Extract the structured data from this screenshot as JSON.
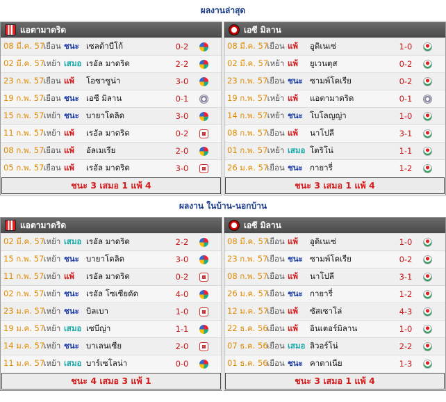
{
  "sections": [
    {
      "title": "ผลงานล่าสุด",
      "left": {
        "team": "แอตามาดริด",
        "logo": "atletico-crest",
        "rows": [
          {
            "date": "08 มี.ค. 57",
            "ha": "เยือน",
            "result": "ชนะ",
            "rclass": "win",
            "opponent": "เซลต้าบีโก้",
            "score": "0-2",
            "comp": "liga"
          },
          {
            "date": "02 มี.ค. 57",
            "ha": "เหย้า",
            "result": "เสมอ",
            "rclass": "draw",
            "opponent": "เรอัล มาดริด",
            "score": "2-2",
            "comp": "liga"
          },
          {
            "date": "23 ก.พ. 57",
            "ha": "เยือน",
            "result": "แพ้",
            "rclass": "loss",
            "opponent": "โอซาซูน่า",
            "score": "3-0",
            "comp": "liga"
          },
          {
            "date": "19 ก.พ. 57",
            "ha": "เยือน",
            "result": "ชนะ",
            "rclass": "win",
            "opponent": "เอซี มิลาน",
            "score": "0-1",
            "comp": "ucl"
          },
          {
            "date": "15 ก.พ. 57",
            "ha": "เหย้า",
            "result": "ชนะ",
            "rclass": "win",
            "opponent": "บายาโดลิด",
            "score": "3-0",
            "comp": "liga"
          },
          {
            "date": "11 ก.พ. 57",
            "ha": "เหย้า",
            "result": "แพ้",
            "rclass": "loss",
            "opponent": "เรอัล มาดริด",
            "score": "0-2",
            "comp": "cup"
          },
          {
            "date": "08 ก.พ. 57",
            "ha": "เยือน",
            "result": "แพ้",
            "rclass": "loss",
            "opponent": "อัลเมเรีย",
            "score": "2-0",
            "comp": "liga"
          },
          {
            "date": "05 ก.พ. 57",
            "ha": "เยือน",
            "result": "แพ้",
            "rclass": "loss",
            "opponent": "เรอัล มาดริด",
            "score": "3-0",
            "comp": "cup"
          }
        ],
        "summary": "ชนะ 3 เสมอ 1 แพ้ 4"
      },
      "right": {
        "team": "เอซี มิลาน",
        "logo": "milan-crest",
        "rows": [
          {
            "date": "08 มี.ค. 57",
            "ha": "เยือน",
            "result": "แพ้",
            "rclass": "loss",
            "opponent": "อูดิเนเซ่",
            "score": "1-0",
            "comp": "seriea"
          },
          {
            "date": "02 มี.ค. 57",
            "ha": "เหย้า",
            "result": "แพ้",
            "rclass": "loss",
            "opponent": "ยูเวนตุส",
            "score": "0-2",
            "comp": "seriea"
          },
          {
            "date": "23 ก.พ. 57",
            "ha": "เยือน",
            "result": "ชนะ",
            "rclass": "win",
            "opponent": "ซามพ์โดเรีย",
            "score": "0-2",
            "comp": "seriea"
          },
          {
            "date": "19 ก.พ. 57",
            "ha": "เหย้า",
            "result": "แพ้",
            "rclass": "loss",
            "opponent": "แอตามาดริด",
            "score": "0-1",
            "comp": "ucl"
          },
          {
            "date": "14 ก.พ. 57",
            "ha": "เหย้า",
            "result": "ชนะ",
            "rclass": "win",
            "opponent": "โบโลญญ่า",
            "score": "1-0",
            "comp": "seriea"
          },
          {
            "date": "08 ก.พ. 57",
            "ha": "เยือน",
            "result": "แพ้",
            "rclass": "loss",
            "opponent": "นาโปลี",
            "score": "3-1",
            "comp": "seriea"
          },
          {
            "date": "01 ก.พ. 57",
            "ha": "เหย้า",
            "result": "เสมอ",
            "rclass": "draw",
            "opponent": "โตริโน่",
            "score": "1-1",
            "comp": "seriea"
          },
          {
            "date": "26 ม.ค. 57",
            "ha": "เยือน",
            "result": "ชนะ",
            "rclass": "win",
            "opponent": "กายารี่",
            "score": "1-2",
            "comp": "seriea"
          }
        ],
        "summary": "ชนะ 3 เสมอ 1 แพ้ 4"
      }
    },
    {
      "title": "ผลงาน ในบ้าน-นอกบ้าน",
      "left": {
        "team": "แอตามาดริด",
        "logo": "atletico-crest",
        "rows": [
          {
            "date": "02 มี.ค. 57",
            "ha": "เหย้า",
            "result": "เสมอ",
            "rclass": "draw",
            "opponent": "เรอัล มาดริด",
            "score": "2-2",
            "comp": "liga"
          },
          {
            "date": "15 ก.พ. 57",
            "ha": "เหย้า",
            "result": "ชนะ",
            "rclass": "win",
            "opponent": "บายาโดลิด",
            "score": "3-0",
            "comp": "liga"
          },
          {
            "date": "11 ก.พ. 57",
            "ha": "เหย้า",
            "result": "แพ้",
            "rclass": "loss",
            "opponent": "เรอัล มาดริด",
            "score": "0-2",
            "comp": "cup"
          },
          {
            "date": "02 ก.พ. 57",
            "ha": "เหย้า",
            "result": "ชนะ",
            "rclass": "win",
            "opponent": "เรอัล โซเซียดัด",
            "score": "4-0",
            "comp": "liga"
          },
          {
            "date": "23 ม.ค. 57",
            "ha": "เหย้า",
            "result": "ชนะ",
            "rclass": "win",
            "opponent": "บิลเบา",
            "score": "1-0",
            "comp": "cup"
          },
          {
            "date": "19 ม.ค. 57",
            "ha": "เหย้า",
            "result": "เสมอ",
            "rclass": "draw",
            "opponent": "เซบีญ่า",
            "score": "1-1",
            "comp": "liga"
          },
          {
            "date": "14 ม.ค. 57",
            "ha": "เหย้า",
            "result": "ชนะ",
            "rclass": "win",
            "opponent": "บาเลนเซีย",
            "score": "2-0",
            "comp": "cup"
          },
          {
            "date": "11 ม.ค. 57",
            "ha": "เหย้า",
            "result": "เสมอ",
            "rclass": "draw",
            "opponent": "บาร์เซโลน่า",
            "score": "0-0",
            "comp": "liga"
          }
        ],
        "summary": "ชนะ 4 เสมอ 3 แพ้ 1"
      },
      "right": {
        "team": "เอซี มิลาน",
        "logo": "milan-crest",
        "rows": [
          {
            "date": "08 มี.ค. 57",
            "ha": "เยือน",
            "result": "แพ้",
            "rclass": "loss",
            "opponent": "อูดิเนเซ่",
            "score": "1-0",
            "comp": "seriea"
          },
          {
            "date": "23 ก.พ. 57",
            "ha": "เยือน",
            "result": "ชนะ",
            "rclass": "win",
            "opponent": "ซามพ์โดเรีย",
            "score": "0-2",
            "comp": "seriea"
          },
          {
            "date": "08 ก.พ. 57",
            "ha": "เยือน",
            "result": "แพ้",
            "rclass": "loss",
            "opponent": "นาโปลี",
            "score": "3-1",
            "comp": "seriea"
          },
          {
            "date": "26 ม.ค. 57",
            "ha": "เยือน",
            "result": "ชนะ",
            "rclass": "win",
            "opponent": "กายารี่",
            "score": "1-2",
            "comp": "seriea"
          },
          {
            "date": "12 ม.ค. 57",
            "ha": "เยือน",
            "result": "แพ้",
            "rclass": "loss",
            "opponent": "ซัสเซาโล่",
            "score": "4-3",
            "comp": "seriea"
          },
          {
            "date": "22 ธ.ค. 56",
            "ha": "เยือน",
            "result": "แพ้",
            "rclass": "loss",
            "opponent": "อินเตอร์มิลาน",
            "score": "1-0",
            "comp": "seriea"
          },
          {
            "date": "07 ธ.ค. 56",
            "ha": "เยือน",
            "result": "เสมอ",
            "rclass": "draw",
            "opponent": "ลิวอร์โน่",
            "score": "2-2",
            "comp": "seriea"
          },
          {
            "date": "01 ธ.ค. 56",
            "ha": "เยือน",
            "result": "ชนะ",
            "rclass": "win",
            "opponent": "คาตาเนีย",
            "score": "1-3",
            "comp": "seriea"
          }
        ],
        "summary": "ชนะ 3 เสมอ 1 แพ้ 4"
      }
    }
  ]
}
